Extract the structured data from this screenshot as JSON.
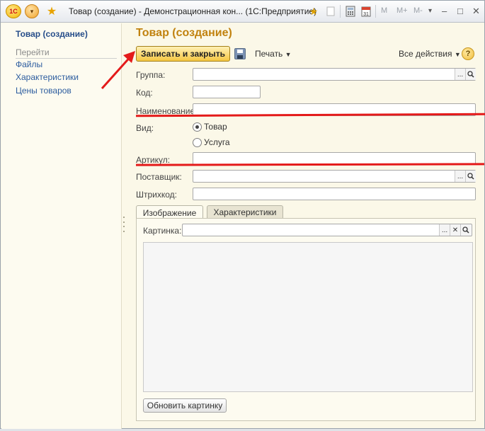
{
  "window": {
    "title": "Товар (создание) - Демонстрационная кон...  (1С:Предприятие)",
    "logo_text": "1С",
    "toolbar_m": "M",
    "toolbar_mplus": "M+",
    "toolbar_mminus": "M-"
  },
  "nav": {
    "title": "Товар (создание)",
    "section": "Перейти",
    "links": [
      "Файлы",
      "Характеристики",
      "Цены товаров"
    ]
  },
  "form": {
    "title": "Товар (создание)",
    "save_close": "Записать и закрыть",
    "print": "Печать",
    "all_actions": "Все действия",
    "help": "?",
    "group_label": "Группа:",
    "group_value": "",
    "code_label": "Код:",
    "code_value": "",
    "name_label": "Наименование:",
    "name_value": "",
    "kind_label": "Вид:",
    "kind_options": [
      "Товар",
      "Услуга"
    ],
    "kind_selected": "Товар",
    "article_label": "Артикул:",
    "article_value": "",
    "supplier_label": "Поставщик:",
    "supplier_value": "",
    "barcode_label": "Штрихкод:",
    "barcode_value": "",
    "tabs": [
      "Изображение",
      "Характеристики"
    ],
    "active_tab": "Изображение",
    "picture_label": "Картинка:",
    "picture_value": "",
    "refresh_picture": "Обновить картинку",
    "select_button": "...",
    "clear_button": "✕",
    "open_button": "🔍"
  },
  "colors": {
    "accent_title": "#c1820f",
    "nav_link": "#2d5d9f",
    "annotation_red": "#e41a1a",
    "save_button": "#f5c742"
  }
}
